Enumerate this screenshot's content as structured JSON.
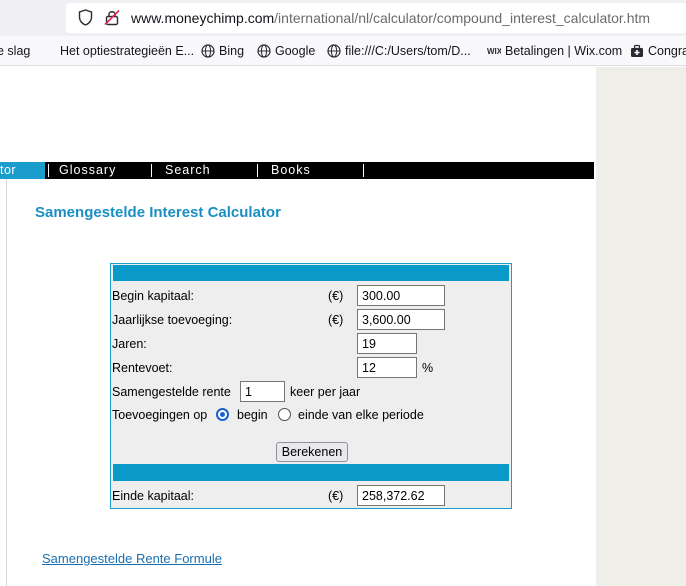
{
  "browser": {
    "url_host": "www.moneychimp.com",
    "url_path": "/international/nl/calculator/compound_interest_calculator.htm"
  },
  "bookmarks": [
    {
      "label": "e slag",
      "icon": "none"
    },
    {
      "label": "Het optiestrategieën E...",
      "icon": "none"
    },
    {
      "label": "Bing",
      "icon": "globe-icon"
    },
    {
      "label": "Google",
      "icon": "globe-icon"
    },
    {
      "label": "file:///C:/Users/tom/D...",
      "icon": "globe-icon"
    },
    {
      "label": "Betalingen | Wix.com",
      "icon": "wix-icon"
    },
    {
      "label": "Congra",
      "icon": "medical-bag-icon"
    }
  ],
  "nav": {
    "active": "tor",
    "items": [
      "Glossary",
      "Search",
      "Books"
    ]
  },
  "page": {
    "title": "Samengestelde Interest Calculator",
    "link": "Samengestelde Rente Formule"
  },
  "calculator": {
    "currency": "(€)",
    "begin_label": "Begin kapitaal:",
    "begin_value": "300.00",
    "annual_label": "Jaarlijkse toevoeging:",
    "annual_value": "3,600.00",
    "years_label": "Jaren:",
    "years_value": "19",
    "rate_label": "Rentevoet:",
    "rate_value": "12",
    "rate_unit": "%",
    "compound_label": "Samengestelde rente",
    "compound_value": "1",
    "compound_suffix": "keer per jaar",
    "additions_label": "Toevoegingen op",
    "option_begin": "begin",
    "option_end": "einde van elke periode",
    "selected_option": "begin",
    "calculate_button": "Berekenen",
    "end_label": "Einde kapitaal:",
    "end_value": "258,372.62"
  },
  "colors": {
    "accent": "#1a9ccc",
    "title": "#1a8fc2",
    "nav_bg": "#000000",
    "link": "#1a6fb0"
  }
}
